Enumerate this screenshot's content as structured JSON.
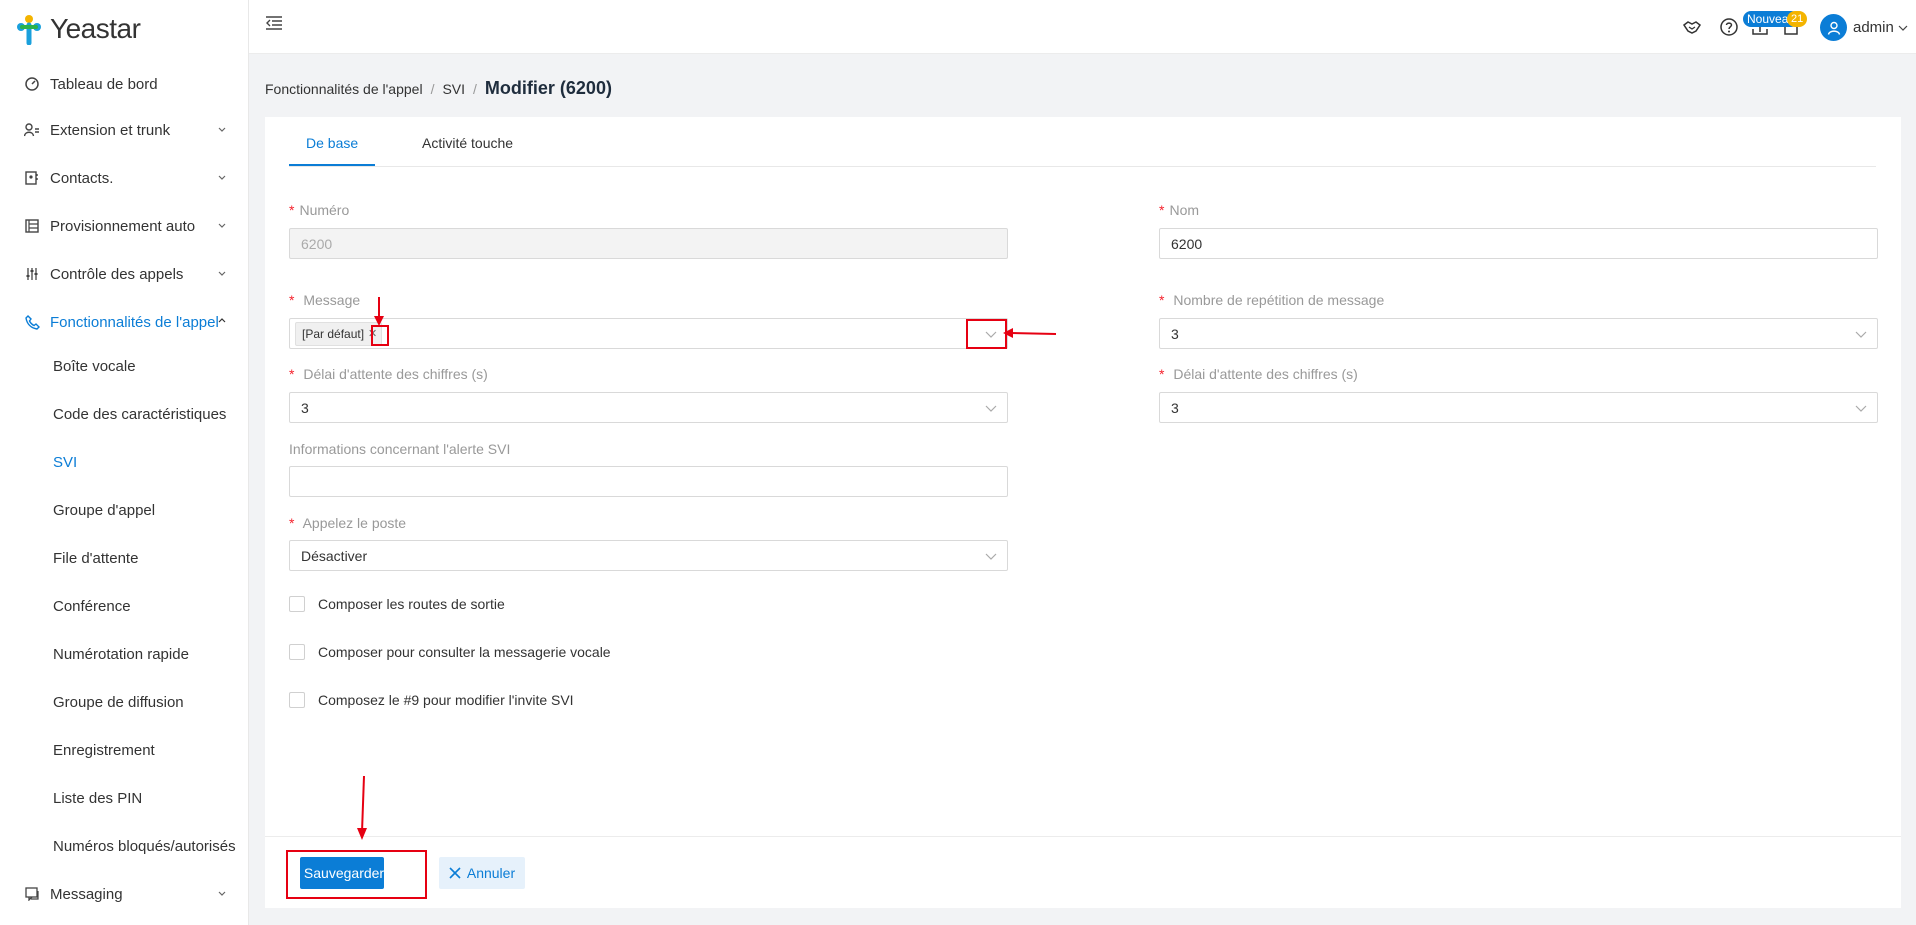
{
  "app": {
    "logo_text": "Yeastar"
  },
  "sidebar": {
    "items": [
      {
        "label": "Tableau de bord",
        "icon": "dashboard-icon",
        "expandable": false
      },
      {
        "label": "Extension et trunk",
        "icon": "user-list-icon",
        "expandable": true
      },
      {
        "label": "Contacts.",
        "icon": "contacts-icon",
        "expandable": true
      },
      {
        "label": "Provisionnement auto",
        "icon": "provisioning-icon",
        "expandable": true
      },
      {
        "label": "Contrôle des appels",
        "icon": "call-control-icon",
        "expandable": true
      },
      {
        "label": "Fonctionnalités de l'appel",
        "icon": "phone-icon",
        "expandable": true,
        "expanded": true,
        "active": true
      },
      {
        "label": "Messaging",
        "icon": "message-icon",
        "expandable": true
      }
    ],
    "sub_items": [
      {
        "label": "Boîte vocale"
      },
      {
        "label": "Code des caractéristiques"
      },
      {
        "label": "SVI",
        "active": true
      },
      {
        "label": "Groupe d'appel"
      },
      {
        "label": "File d'attente"
      },
      {
        "label": "Conférence"
      },
      {
        "label": "Numérotation rapide"
      },
      {
        "label": "Groupe de diffusion"
      },
      {
        "label": "Enregistrement"
      },
      {
        "label": "Liste des PIN"
      },
      {
        "label": "Numéros bloqués/autorisés"
      }
    ]
  },
  "header": {
    "new_badge": "Nouveau",
    "count_badge": "21",
    "user": "admin"
  },
  "breadcrumb": {
    "level1": "Fonctionnalités de l'appel",
    "level2": "SVI",
    "current": "Modifier (6200)"
  },
  "tabs": [
    {
      "label": "De base",
      "active": true
    },
    {
      "label": "Activité touche",
      "active": false
    }
  ],
  "form": {
    "numero": {
      "label": "Numéro",
      "value": "6200",
      "disabled": true
    },
    "nom": {
      "label": "Nom",
      "value": "6200"
    },
    "message": {
      "label": "Message",
      "tag": "[Par défaut]"
    },
    "repetition": {
      "label": "Nombre de repétition de message",
      "value": "3"
    },
    "delai1": {
      "label": "Délai d'attente des chiffres (s)",
      "value": "3"
    },
    "delai2": {
      "label": "Délai d'attente des chiffres (s)",
      "value": "3"
    },
    "alerte": {
      "label": "Informations concernant l'alerte SVI",
      "value": ""
    },
    "poste": {
      "label": "Appelez le poste",
      "value": "Désactiver"
    },
    "checkboxes": [
      {
        "label": "Composer les routes de sortie",
        "checked": false
      },
      {
        "label": "Composer pour consulter la messagerie vocale",
        "checked": false
      },
      {
        "label": "Composez le #9 pour modifier l'invite SVI",
        "checked": false
      }
    ]
  },
  "actions": {
    "save": "Sauvegarder",
    "cancel": "Annuler"
  },
  "colors": {
    "primary": "#0b7dd6",
    "required": "#f5222d",
    "annotation": "#e60012"
  }
}
